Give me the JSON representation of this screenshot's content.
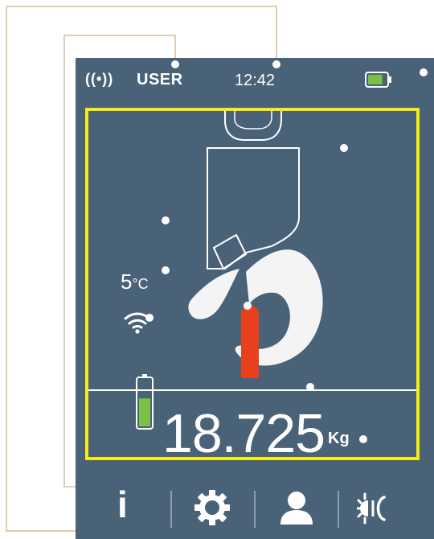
{
  "status_bar": {
    "signal_icon": "((•))",
    "user_label": "USER",
    "time": "12:42",
    "battery_icon": "battery-icon",
    "battery_level": 0.8
  },
  "display": {
    "temperature_value": "5",
    "temperature_unit": "°C",
    "wifi_icon": "wifi-icon",
    "load_indicator_color": "#e8401c",
    "side_battery_level": 0.6,
    "weight_value": "18.725",
    "weight_unit": "Kg"
  },
  "nav_bar": {
    "info_label": "i",
    "settings_icon": "gear-icon",
    "user_icon": "user-icon",
    "day_night_icon": "sun-moon-icon"
  },
  "colors": {
    "screen_bg": "#4a6278",
    "frame": "#f7ec14",
    "leader_line": "#d9b99a",
    "battery_fill": "#7ac143",
    "load_bar": "#e8401c"
  }
}
